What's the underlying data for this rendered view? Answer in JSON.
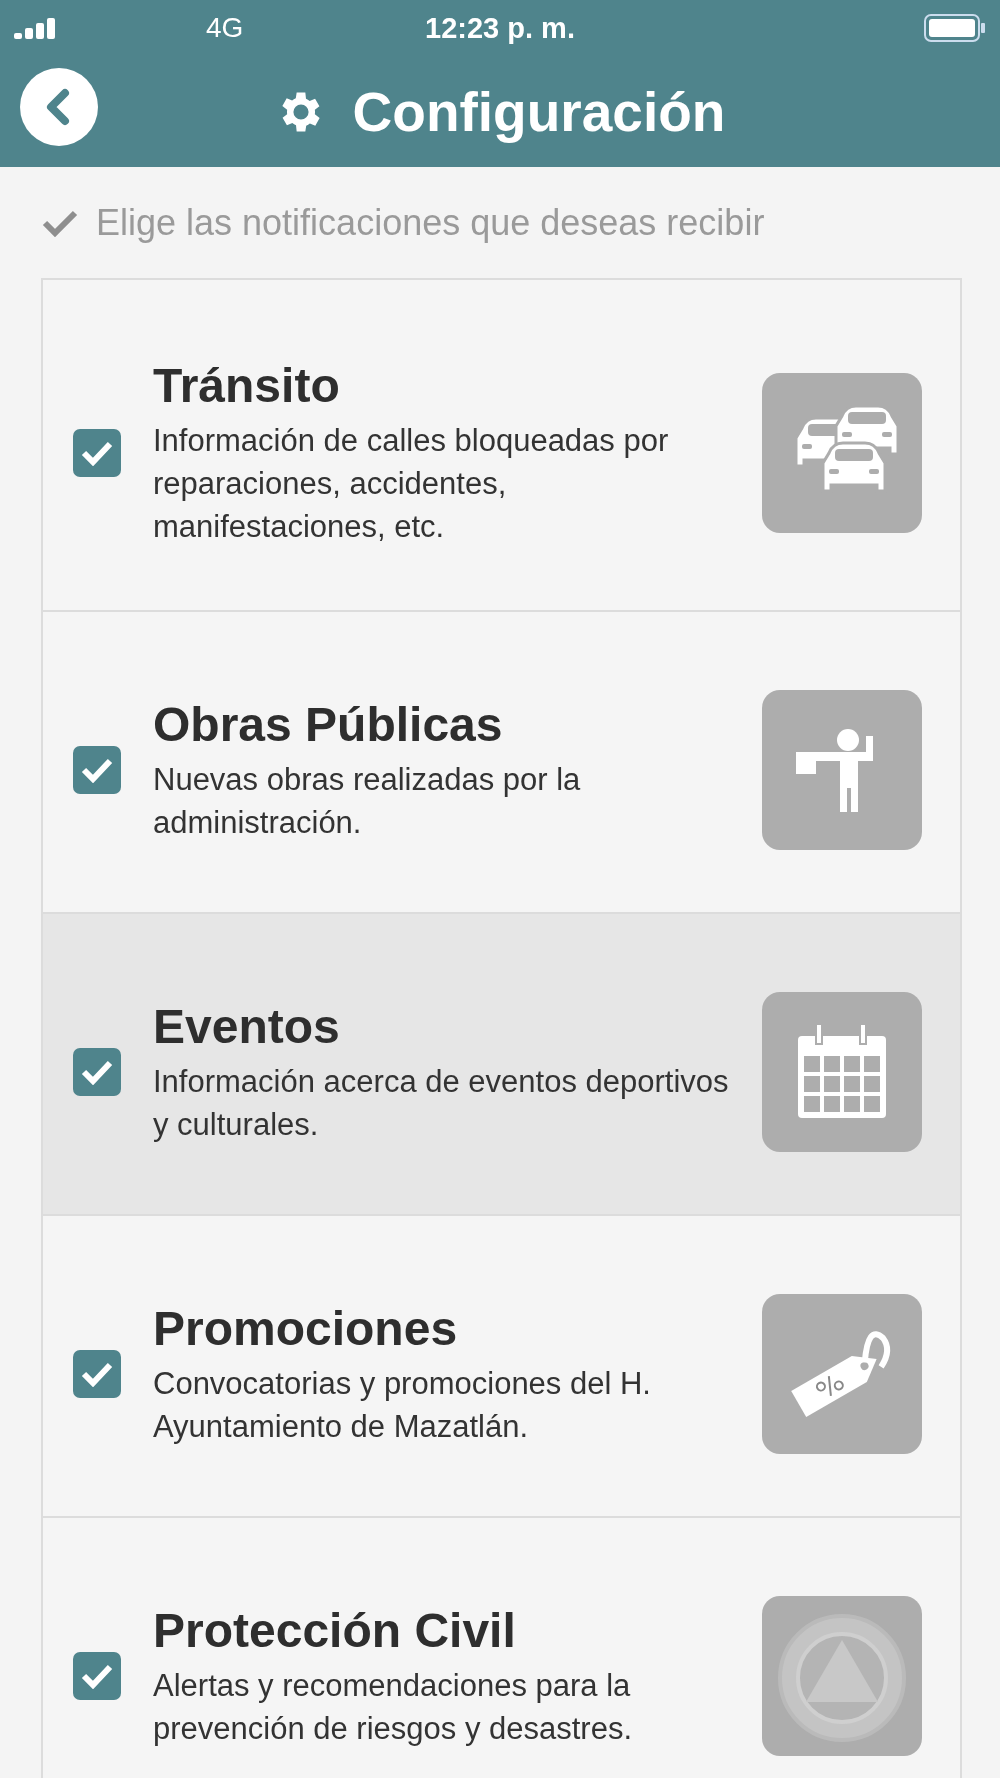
{
  "status_bar": {
    "carrier": "4G",
    "time": "12:23 p. m."
  },
  "header": {
    "title": "Configuración"
  },
  "subtitle": "Elige las notificaciones que deseas recibir",
  "options": [
    {
      "title": "Tránsito",
      "description": "Información de calles bloqueadas por reparaciones, accidentes, manifestaciones, etc.",
      "checked": true,
      "selected": false,
      "kind": "cars"
    },
    {
      "title": "Obras Públicas",
      "description": "Nuevas obras realizadas por la administración.",
      "checked": true,
      "selected": false,
      "kind": "worker"
    },
    {
      "title": "Eventos",
      "description": "Información acerca de eventos deportivos y culturales.",
      "checked": true,
      "selected": true,
      "kind": "calendar"
    },
    {
      "title": "Promociones",
      "description": "Convocatorias y promociones del H. Ayuntamiento de Mazatlán.",
      "checked": true,
      "selected": false,
      "kind": "tag"
    },
    {
      "title": "Protección Civil",
      "description": "Alertas y recomendaciones para la prevención de riesgos y desastres.",
      "checked": true,
      "selected": false,
      "kind": "seal"
    }
  ]
}
